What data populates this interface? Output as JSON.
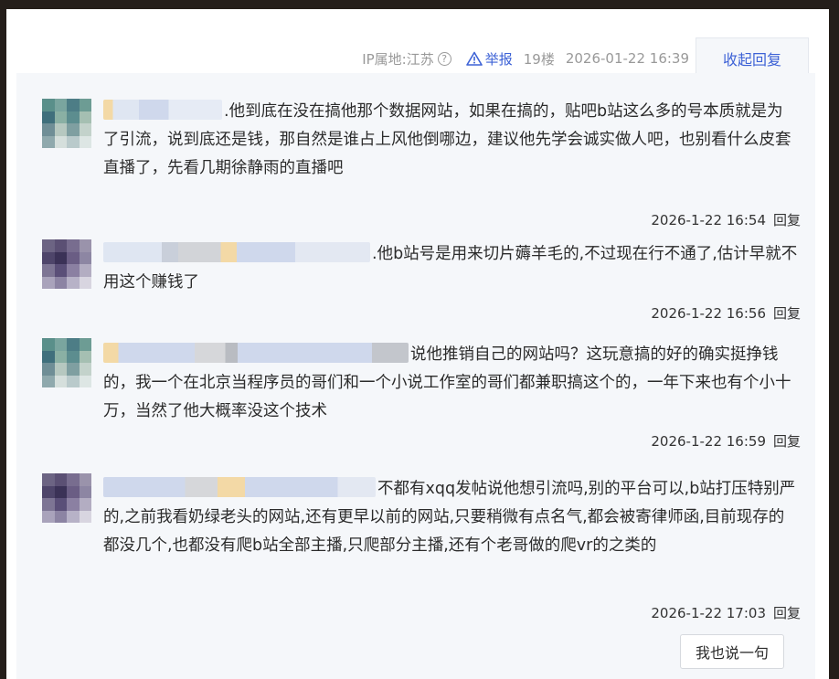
{
  "post_meta": {
    "ip_location": "IP属地:江苏",
    "help_icon": "question-circle-icon",
    "report_label": "举报",
    "floor": "19楼",
    "datetime": "2026-01-22 16:39",
    "collapse_label": "收起回复"
  },
  "replies": [
    {
      "text": ".他到底在没在搞他那个数据网站，如果在搞的，贴吧b站这么多的号本质就是为了引流，说到底还是钱，那自然是谁占上风他倒哪边，建议他先学会诚实做人吧，也别看什么皮套直播了，先看几期徐静雨的直播吧",
      "time": "2026-1-22 16:54",
      "reply_label": "回复"
    },
    {
      "text": ".他b站号是用来切片薅羊毛的,不过现在行不通了,估计早就不用这个赚钱了",
      "time": "2026-1-22 16:56",
      "reply_label": "回复"
    },
    {
      "text": "说他推销自己的网站吗？这玩意搞的好的确实挺挣钱的，我一个在北京当程序员的哥们和一个小说工作室的哥们都兼职搞这个的，一年下来也有个小十万，当然了他大概率没这个技术",
      "time": "2026-1-22 16:59",
      "reply_label": "回复"
    },
    {
      "text": "不都有xqq发帖说他想引流吗,别的平台可以,b站打压特别严的,之前我看奶绿老头的网站,还有更早以前的网站,只要稍微有点名气,都会被寄律师函,目前现存的都没几个,也都没有爬b站全部主播,只爬部分主播,还有个老哥做的爬vr的之类的",
      "time": "2026-1-22 17:03",
      "reply_label": "回复"
    }
  ],
  "say_button_label": "我也说一句",
  "colors": {
    "link_blue": "#3d62d6",
    "thread_bg": "#f5f7fa",
    "meta_gray": "#999999"
  }
}
